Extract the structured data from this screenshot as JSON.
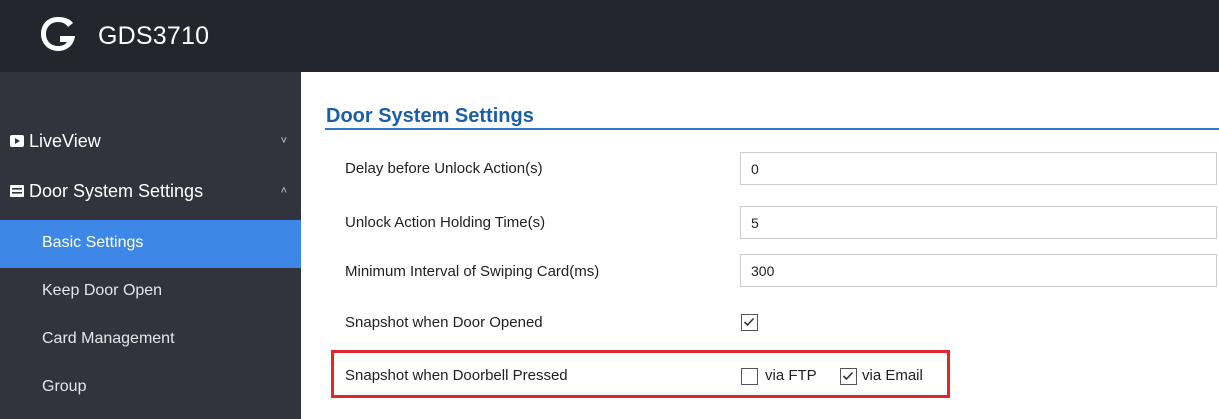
{
  "app": {
    "title": "GDS3710"
  },
  "sidebar": {
    "items": [
      {
        "label": "LiveView",
        "icon": "video-icon",
        "chevron": "˅"
      },
      {
        "label": "Door System Settings",
        "icon": "panel-icon",
        "chevron": "˄"
      }
    ],
    "subitems": [
      {
        "label": "Basic Settings",
        "active": true
      },
      {
        "label": "Keep Door Open"
      },
      {
        "label": "Card Management"
      },
      {
        "label": "Group"
      }
    ]
  },
  "main": {
    "title": "Door System Settings",
    "rows": [
      {
        "label": "Delay before Unlock Action(s)",
        "value": "0"
      },
      {
        "label": "Unlock Action Holding Time(s)",
        "value": "5"
      },
      {
        "label": "Minimum Interval of Swiping Card(ms)",
        "value": "300"
      },
      {
        "label": "Snapshot when Door Opened",
        "checked": true
      },
      {
        "label": "Snapshot when Doorbell Pressed",
        "options": [
          {
            "label": "via FTP",
            "checked": false
          },
          {
            "label": "via Email",
            "checked": true
          }
        ]
      }
    ]
  },
  "colors": {
    "topbar": "#23262d",
    "sidebar": "#31343d",
    "active": "#3d88e6",
    "title": "#1a5ea8",
    "highlight": "#e3262c"
  }
}
